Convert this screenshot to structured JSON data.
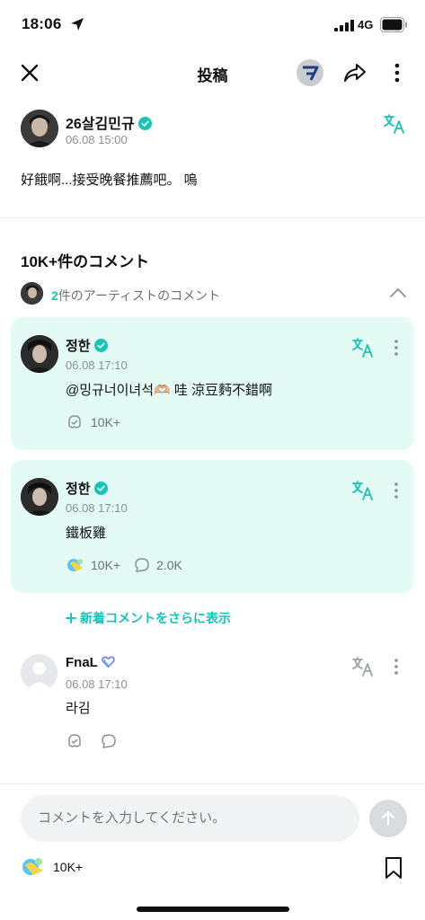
{
  "status_bar": {
    "time": "18:06",
    "network": "4G"
  },
  "nav": {
    "title": "投稿"
  },
  "post": {
    "author": "26살김민규",
    "date": "06.08 15:00",
    "body": "好餓啊...接受晚餐推薦吧。 嗚"
  },
  "comments_section": {
    "title": "10K+件のコメント",
    "artist_count": "2",
    "artist_label": "件のアーティストのコメント"
  },
  "artist_comments": [
    {
      "name": "정한",
      "date": "06.08 17:10",
      "body": "@밍규너이녀석🫶🏼 哇 涼豆麪不錯啊",
      "likes": "10K+"
    },
    {
      "name": "정한",
      "date": "06.08 17:10",
      "body": "鐵板雞",
      "likes": "10K+",
      "replies": "2.0K"
    }
  ],
  "more_comments_label": "新着コメントをさらに表示",
  "fan_comment": {
    "name": "FnaL",
    "date": "06.08 17:10",
    "body": "라김"
  },
  "input": {
    "placeholder": "コメントを入力してください。"
  },
  "footer": {
    "reaction_count": "10K+"
  },
  "colors": {
    "accent": "#19c3b7",
    "artist_card_bg": "#e3faf5"
  },
  "icons": [
    "location-arrow-icon",
    "signal-icon",
    "battery-icon",
    "close-icon",
    "community-logo-icon",
    "share-icon",
    "more-icon",
    "verified-icon",
    "translate-icon",
    "chevron-up-icon",
    "like-icon",
    "reply-icon",
    "plus-icon",
    "send-icon",
    "bookmark-icon"
  ]
}
